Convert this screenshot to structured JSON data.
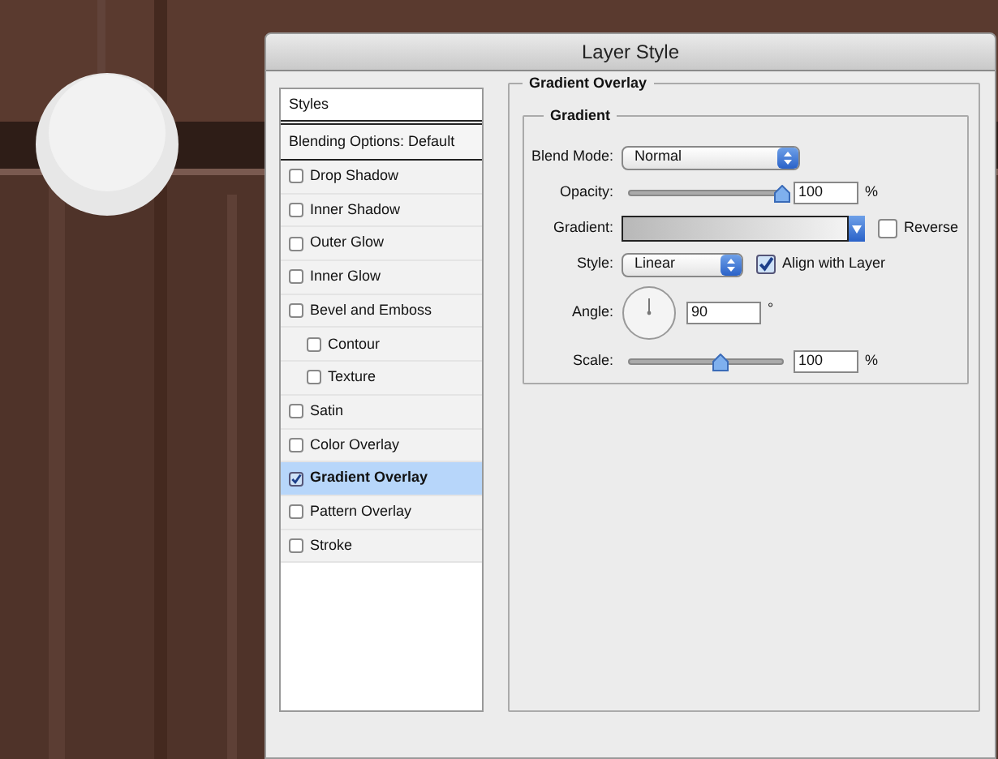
{
  "window": {
    "title": "Layer Style"
  },
  "styles_list": {
    "header": "Styles",
    "items": [
      {
        "label": "Blending Options: Default",
        "kind": "header",
        "selected": false
      },
      {
        "label": "Drop Shadow",
        "kind": "checkbox",
        "checked": false,
        "selected": false
      },
      {
        "label": "Inner Shadow",
        "kind": "checkbox",
        "checked": false,
        "selected": false
      },
      {
        "label": "Outer Glow",
        "kind": "checkbox",
        "checked": false,
        "selected": false
      },
      {
        "label": "Inner Glow",
        "kind": "checkbox",
        "checked": false,
        "selected": false
      },
      {
        "label": "Bevel and Emboss",
        "kind": "checkbox",
        "checked": false,
        "selected": false,
        "children": [
          {
            "label": "Contour",
            "kind": "checkbox",
            "checked": false,
            "selected": false
          },
          {
            "label": "Texture",
            "kind": "checkbox",
            "checked": false,
            "selected": false
          }
        ]
      },
      {
        "label": "Satin",
        "kind": "checkbox",
        "checked": false,
        "selected": false
      },
      {
        "label": "Color Overlay",
        "kind": "checkbox",
        "checked": false,
        "selected": false
      },
      {
        "label": "Gradient Overlay",
        "kind": "checkbox",
        "checked": true,
        "selected": true
      },
      {
        "label": "Pattern Overlay",
        "kind": "checkbox",
        "checked": false,
        "selected": false
      },
      {
        "label": "Stroke",
        "kind": "checkbox",
        "checked": false,
        "selected": false
      }
    ]
  },
  "panel": {
    "title": "Gradient Overlay",
    "group": {
      "title": "Gradient",
      "blend_mode": {
        "label": "Blend Mode:",
        "value": "Normal"
      },
      "opacity": {
        "label": "Opacity:",
        "level": 1.0,
        "value": "100",
        "unit": "%"
      },
      "gradient": {
        "label": "Gradient:"
      },
      "reverse": {
        "label": "Reverse",
        "checked": false
      },
      "style": {
        "label": "Style:",
        "value": "Linear"
      },
      "align": {
        "label": "Align with Layer",
        "checked": true
      },
      "angle": {
        "label": "Angle:",
        "value": "90",
        "unit": "°"
      },
      "scale": {
        "label": "Scale:",
        "level": 0.6,
        "value": "100",
        "unit": "%"
      }
    }
  }
}
